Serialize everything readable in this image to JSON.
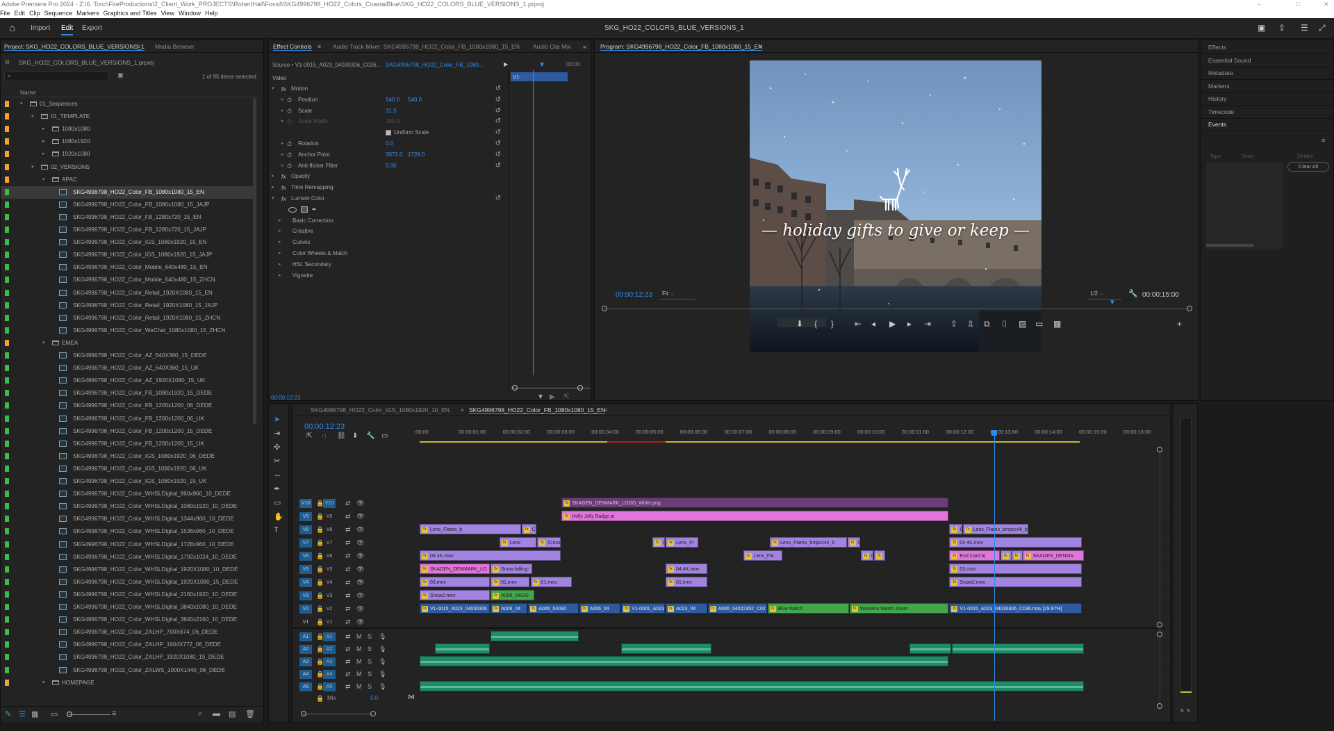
{
  "app": {
    "titlebar": "Adobe Premiere Pro 2024 - Z:\\6. TorchFireProductions\\2_Client_Work_PROJECTS\\RobertHall\\Fossil\\SKG4996798_HO22_Colors_CoastalBlue\\SKG_HO22_COLORS_BLUE_VERSIONS_1.prproj",
    "menus": [
      "File",
      "Edit",
      "Clip",
      "Sequence",
      "Markers",
      "Graphics and Titles",
      "View",
      "Window",
      "Help"
    ],
    "workspaces": [
      "Import",
      "Edit",
      "Export"
    ],
    "document_title": "SKG_HO22_COLORS_BLUE_VERSIONS_1"
  },
  "project": {
    "tab": "Project: SKG_HO22_COLORS_BLUE_VERSIONS_1",
    "tab_menu": "≡",
    "tab2": "Media Browser",
    "file": "SKG_HO22_COLORS_BLUE_VERSIONS_1.prproj",
    "count": "1 of 95 items selected",
    "col_name": "Name",
    "items": [
      {
        "t": "f",
        "d": 0,
        "n": "01_Sequences",
        "c": "#f5a230",
        "o": true
      },
      {
        "t": "f",
        "d": 1,
        "n": "01_TEMPLATE",
        "c": "#f5a230",
        "o": true
      },
      {
        "t": "f",
        "d": 2,
        "n": "1080x1080",
        "c": "#f5a230",
        "o": false
      },
      {
        "t": "f",
        "d": 2,
        "n": "1080x1920",
        "c": "#f5a230",
        "o": false
      },
      {
        "t": "f",
        "d": 2,
        "n": "1920x1080",
        "c": "#f5a230",
        "o": false
      },
      {
        "t": "f",
        "d": 1,
        "n": "02_VERSIONS",
        "c": "#f5a230",
        "o": true
      },
      {
        "t": "f",
        "d": 2,
        "n": "APAC",
        "c": "#f5a230",
        "o": true
      },
      {
        "t": "s",
        "d": 3,
        "n": "SKG4996798_HO22_Color_FB_1080x1080_15_EN",
        "c": "#3dbb47",
        "sel": true
      },
      {
        "t": "s",
        "d": 3,
        "n": "SKG4996798_HO22_Color_FB_1080x1080_15_JAJP",
        "c": "#3dbb47"
      },
      {
        "t": "s",
        "d": 3,
        "n": "SKG4996798_HO22_Color_FB_1280x720_15_EN",
        "c": "#3dbb47"
      },
      {
        "t": "s",
        "d": 3,
        "n": "SKG4996798_HO22_Color_FB_1280x720_15_JAJP",
        "c": "#3dbb47"
      },
      {
        "t": "s",
        "d": 3,
        "n": "SKG4996798_HO22_Color_IGS_1080x1920_15_EN",
        "c": "#3dbb47"
      },
      {
        "t": "s",
        "d": 3,
        "n": "SKG4996798_HO22_Color_IGS_1080x1920_15_JAJP",
        "c": "#3dbb47"
      },
      {
        "t": "s",
        "d": 3,
        "n": "SKG4996798_HO22_Color_Mobile_640x480_15_EN",
        "c": "#3dbb47"
      },
      {
        "t": "s",
        "d": 3,
        "n": "SKG4996798_HO22_Color_Mobile_640x480_15_ZHCN",
        "c": "#3dbb47"
      },
      {
        "t": "s",
        "d": 3,
        "n": "SKG4996798_HO22_Color_Retail_1920X1080_15_EN",
        "c": "#3dbb47"
      },
      {
        "t": "s",
        "d": 3,
        "n": "SKG4996798_HO22_Color_Retail_1920X1080_15_JAJP",
        "c": "#3dbb47"
      },
      {
        "t": "s",
        "d": 3,
        "n": "SKG4996798_HO22_Color_Retail_1920X1080_15_ZHCN",
        "c": "#3dbb47"
      },
      {
        "t": "s",
        "d": 3,
        "n": "SKG4996798_HO22_Color_WeChat_1080x1080_15_ZHCN",
        "c": "#3dbb47"
      },
      {
        "t": "f",
        "d": 2,
        "n": "EMEA",
        "c": "#f5a230",
        "o": true
      },
      {
        "t": "s",
        "d": 3,
        "n": "SKG4996798_HO22_Color_AZ_640X360_15_DEDE",
        "c": "#3dbb47"
      },
      {
        "t": "s",
        "d": 3,
        "n": "SKG4996798_HO22_Color_AZ_640X360_15_UK",
        "c": "#3dbb47"
      },
      {
        "t": "s",
        "d": 3,
        "n": "SKG4996798_HO22_Color_AZ_1920X1080_15_UK",
        "c": "#3dbb47"
      },
      {
        "t": "s",
        "d": 3,
        "n": "SKG4996798_HO22_Color_FB_1080x1920_15_DEDE",
        "c": "#3dbb47"
      },
      {
        "t": "s",
        "d": 3,
        "n": "SKG4996798_HO22_Color_FB_1200x1200_06_DEDE",
        "c": "#3dbb47"
      },
      {
        "t": "s",
        "d": 3,
        "n": "SKG4996798_HO22_Color_FB_1200x1200_06_UK",
        "c": "#3dbb47"
      },
      {
        "t": "s",
        "d": 3,
        "n": "SKG4996798_HO22_Color_FB_1200x1200_15_DEDE",
        "c": "#3dbb47"
      },
      {
        "t": "s",
        "d": 3,
        "n": "SKG4996798_HO22_Color_FB_1200x1200_15_UK",
        "c": "#3dbb47"
      },
      {
        "t": "s",
        "d": 3,
        "n": "SKG4996798_HO22_Color_IGS_1080x1920_06_DEDE",
        "c": "#3dbb47"
      },
      {
        "t": "s",
        "d": 3,
        "n": "SKG4996798_HO22_Color_IGS_1080x1920_06_UK",
        "c": "#3dbb47"
      },
      {
        "t": "s",
        "d": 3,
        "n": "SKG4996798_HO22_Color_IGS_1080x1920_15_UK",
        "c": "#3dbb47"
      },
      {
        "t": "s",
        "d": 3,
        "n": "SKG4996798_HO22_Color_WHSLDigital_960x960_10_DEDE",
        "c": "#3dbb47"
      },
      {
        "t": "s",
        "d": 3,
        "n": "SKG4996798_HO22_Color_WHSLDigital_1080x1920_10_DEDE",
        "c": "#3dbb47"
      },
      {
        "t": "s",
        "d": 3,
        "n": "SKG4996798_HO22_Color_WHSLDigital_1344x960_10_DEDE",
        "c": "#3dbb47"
      },
      {
        "t": "s",
        "d": 3,
        "n": "SKG4996798_HO22_Color_WHSLDigital_1536x960_10_DEDE",
        "c": "#3dbb47"
      },
      {
        "t": "s",
        "d": 3,
        "n": "SKG4996798_HO22_Color_WHSLDigital_1728x960_10_DEDE",
        "c": "#3dbb47"
      },
      {
        "t": "s",
        "d": 3,
        "n": "SKG4996798_HO22_Color_WHSLDigital_1792x1024_10_DEDE",
        "c": "#3dbb47"
      },
      {
        "t": "s",
        "d": 3,
        "n": "SKG4996798_HO22_Color_WHSLDigital_1920X1080_10_DEDE",
        "c": "#3dbb47"
      },
      {
        "t": "s",
        "d": 3,
        "n": "SKG4996798_HO22_Color_WHSLDigital_1920X1080_15_DEDE",
        "c": "#3dbb47"
      },
      {
        "t": "s",
        "d": 3,
        "n": "SKG4996798_HO22_Color_WHSLDigital_2160x1920_10_DEDE",
        "c": "#3dbb47"
      },
      {
        "t": "s",
        "d": 3,
        "n": "SKG4996798_HO22_Color_WHSLDigital_3840x1080_10_DEDE",
        "c": "#3dbb47"
      },
      {
        "t": "s",
        "d": 3,
        "n": "SKG4996798_HO22_Color_WHSLDigital_3840x2160_10_DEDE",
        "c": "#3dbb47"
      },
      {
        "t": "s",
        "d": 3,
        "n": "SKG4996798_HO22_Color_ZALHP_700X674_06_DEDE",
        "c": "#3dbb47"
      },
      {
        "t": "s",
        "d": 3,
        "n": "SKG4996798_HO22_Color_ZALHP_1604X772_06_DEDE",
        "c": "#3dbb47"
      },
      {
        "t": "s",
        "d": 3,
        "n": "SKG4996798_HO22_Color_ZALHP_1920X1080_15_DEDE",
        "c": "#3dbb47"
      },
      {
        "t": "s",
        "d": 3,
        "n": "SKG4996798_HO22_Color_ZALWS_1000X1440_06_DEDE",
        "c": "#3dbb47"
      },
      {
        "t": "f",
        "d": 2,
        "n": "HOMEPAGE",
        "c": "#f5a230",
        "o": true
      }
    ]
  },
  "effects": {
    "tabs": [
      "Effect Controls",
      "Audio Track Mixer: SKG4996798_HO22_Color_FB_1080x1080_15_EN",
      "Audio Clip Mix"
    ],
    "source": "Source • V1-0015_A023_04030306_C036...",
    "sequence": "SKG4996798_HO22_Color_FB_1080...",
    "clip_label": "V1-0015_A023_04030306",
    "ruler": "00:00",
    "video": "Video",
    "rows": [
      {
        "k": "sec",
        "label": "Motion",
        "fx": true,
        "reset": true
      },
      {
        "k": "p",
        "label": "Position",
        "v1": "540.0",
        "v2": "540.0",
        "reset": true
      },
      {
        "k": "p",
        "label": "Scale",
        "v1": "31.5",
        "reset": true
      },
      {
        "k": "p",
        "label": "Scale Width",
        "v1": "100.0",
        "dim": true,
        "reset": true
      },
      {
        "k": "chk",
        "label": "Uniform Scale",
        "reset": true
      },
      {
        "k": "p",
        "label": "Rotation",
        "v1": "0.0",
        "reset": true
      },
      {
        "k": "p",
        "label": "Anchor Point",
        "v1": "3072.0",
        "v2": "1728.0",
        "reset": true
      },
      {
        "k": "p",
        "label": "Anti-flicker Filter",
        "v1": "0.00",
        "reset": true
      },
      {
        "k": "sec",
        "label": "Opacity",
        "fx": true
      },
      {
        "k": "sec",
        "label": "Time Remapping",
        "fx": true
      },
      {
        "k": "sec",
        "label": "Lumetri Color",
        "fx": true,
        "reset": true
      },
      {
        "k": "shapes"
      },
      {
        "k": "sub",
        "label": "Basic Correction"
      },
      {
        "k": "sub",
        "label": "Creative"
      },
      {
        "k": "sub",
        "label": "Curves"
      },
      {
        "k": "sub",
        "label": "Color Wheels & Match"
      },
      {
        "k": "sub",
        "label": "HSL Secondary"
      },
      {
        "k": "sub",
        "label": "Vignette"
      }
    ],
    "timecode": "00:00:12:23"
  },
  "program": {
    "tab": "Program: SKG4996798_HO22_Color_FB_1080x1080_15_EN",
    "tab_menu": "≡",
    "caption": "— holiday gifts to give or keep —",
    "timecode": "00:00:12:23",
    "fit": "Fit",
    "resolution": "1/2",
    "duration": "00:00:15:00"
  },
  "timeline": {
    "tabs": [
      "SKG4996798_HO22_Color_IGS_1080x1920_10_EN",
      "SKG4996798_HO22_Color_FB_1080x1080_15_EN"
    ],
    "timecode": "00:00:12:23",
    "ruler": [
      ":00:00",
      "00:00:01:00",
      "00:00:02:00",
      "00:00:03:00",
      "00:00:04:00",
      "00:00:05:00",
      "00:00:06:00",
      "00:00:07:00",
      "00:00:08:00",
      "00:00:09:00",
      "00:00:10:00",
      "00:00:11:00",
      "00:00:12:00",
      "00:00:13:00",
      "00:00:14:00",
      "00:00:15:00",
      "00:00:16:00"
    ],
    "playhead_seconds": 12.96,
    "vtracks": [
      "V10",
      "V9",
      "V8",
      "V7",
      "V6",
      "V5",
      "V4",
      "V3",
      "V2",
      "V1"
    ],
    "atracks": [
      "A1",
      "A2",
      "A3",
      "A4",
      "A5"
    ],
    "mix": "Mix",
    "mix_value": "0.0",
    "vclips": [
      {
        "tr": 0,
        "s": 3.2,
        "e": 11.95,
        "n": "SKAGEN_DENMARK_LOGO_White.png",
        "c": "dpurp"
      },
      {
        "tr": 1,
        "s": 3.2,
        "e": 11.95,
        "n": "Holly Jolly Badge.ai",
        "c": "pink"
      },
      {
        "tr": 2,
        "s": 0,
        "e": 2.3,
        "n": "Lens_Flares_b",
        "c": "violet"
      },
      {
        "tr": 2,
        "s": 2.3,
        "e": 2.65,
        "n": "Cross",
        "c": "violet"
      },
      {
        "tr": 2,
        "s": 11.95,
        "e": 12.25,
        "n": "Cro",
        "c": "violet"
      },
      {
        "tr": 2,
        "s": 12.25,
        "e": 13.75,
        "n": "Lens_Flares_bmpcc4k_by_",
        "c": "violet"
      },
      {
        "tr": 3,
        "s": 1.8,
        "e": 2.65,
        "n": "Lens",
        "c": "violet"
      },
      {
        "tr": 3,
        "s": 2.65,
        "e": 3.2,
        "n": "Cross D",
        "c": "violet"
      },
      {
        "tr": 3,
        "s": 5.25,
        "e": 5.55,
        "n": "Cro",
        "c": "violet"
      },
      {
        "tr": 3,
        "s": 5.55,
        "e": 6.3,
        "n": "Lens_Fl",
        "c": "violet"
      },
      {
        "tr": 3,
        "s": 7.9,
        "e": 9.65,
        "n": "Lens_Flares_bmpcc4k_b",
        "c": "violet"
      },
      {
        "tr": 3,
        "s": 9.65,
        "e": 9.95,
        "n": "Cr",
        "c": "violet"
      },
      {
        "tr": 3,
        "s": 11.95,
        "e": 14.95,
        "n": "04 4K.mov",
        "c": "violet"
      },
      {
        "tr": 4,
        "s": 0,
        "e": 3.2,
        "n": "04 4K.mov",
        "c": "violet"
      },
      {
        "tr": 4,
        "s": 7.3,
        "e": 8.2,
        "n": "Lens_Fla",
        "c": "violet"
      },
      {
        "tr": 4,
        "s": 9.95,
        "e": 10.25,
        "n": "Cr",
        "c": "violet"
      },
      {
        "tr": 4,
        "s": 10.25,
        "e": 10.5,
        "n": "Cr",
        "c": "violet"
      },
      {
        "tr": 4,
        "s": 11.95,
        "e": 13.1,
        "n": "End Card.ai",
        "c": "pink"
      },
      {
        "tr": 4,
        "s": 13.1,
        "e": 13.35,
        "n": "Cr",
        "c": "violet"
      },
      {
        "tr": 4,
        "s": 13.35,
        "e": 13.6,
        "n": "Cr",
        "c": "violet"
      },
      {
        "tr": 4,
        "s": 13.6,
        "e": 15,
        "n": "SKAGEN_DENMA",
        "c": "pink"
      },
      {
        "tr": 5,
        "s": 0,
        "e": 1.6,
        "n": "SKAGEN_DENMARK_LO",
        "c": "pink"
      },
      {
        "tr": 5,
        "s": 1.6,
        "e": 2.55,
        "n": "Snow-falling-",
        "c": "violet"
      },
      {
        "tr": 5,
        "s": 5.55,
        "e": 6.5,
        "n": "04 4K.mov",
        "c": "violet"
      },
      {
        "tr": 5,
        "s": 11.95,
        "e": 14.95,
        "n": "03.mov",
        "c": "violet"
      },
      {
        "tr": 6,
        "s": 0,
        "e": 1.6,
        "n": "03.mov",
        "c": "violet"
      },
      {
        "tr": 6,
        "s": 1.6,
        "e": 2.5,
        "n": "01.mov",
        "c": "violet"
      },
      {
        "tr": 6,
        "s": 2.5,
        "e": 3.45,
        "n": "01.mov",
        "c": "violet"
      },
      {
        "tr": 6,
        "s": 5.55,
        "e": 6.5,
        "n": "01.mov",
        "c": "violet"
      },
      {
        "tr": 6,
        "s": 11.95,
        "e": 14.95,
        "n": "Snow2.mov",
        "c": "violet"
      },
      {
        "tr": 7,
        "s": 0,
        "e": 1.6,
        "n": "Snow2.mov",
        "c": "violet"
      },
      {
        "tr": 7,
        "s": 1.6,
        "e": 2.6,
        "n": "A006_04030",
        "c": "green"
      },
      {
        "tr": 8,
        "s": 0,
        "e": 1.6,
        "n": "V1-0015_A023_04030306",
        "c": "vclip"
      },
      {
        "tr": 8,
        "s": 1.6,
        "e": 2.45,
        "n": "A006_04",
        "c": "vclip"
      },
      {
        "tr": 8,
        "s": 2.45,
        "e": 3.6,
        "n": "A006_04030",
        "c": "vclip"
      },
      {
        "tr": 8,
        "s": 3.6,
        "e": 4.55,
        "n": "A006_04",
        "c": "vclip"
      },
      {
        "tr": 8,
        "s": 4.55,
        "e": 5.55,
        "n": "V1-0001_A023_",
        "c": "vclip"
      },
      {
        "tr": 8,
        "s": 5.55,
        "e": 6.5,
        "n": "A023_04",
        "c": "vclip"
      },
      {
        "tr": 8,
        "s": 6.5,
        "e": 7.85,
        "n": "A006_04022352_C021.b",
        "c": "vclip"
      },
      {
        "tr": 8,
        "s": 7.85,
        "e": 9.7,
        "n": "Blue Watch",
        "c": "green"
      },
      {
        "tr": 8,
        "s": 9.7,
        "e": 11.95,
        "n": "Womens Watch Zoom",
        "c": "green"
      },
      {
        "tr": 8,
        "s": 11.95,
        "e": 14.95,
        "n": "V1-0015_A023_04030306_C036.mov [29.97%]",
        "c": "vclip"
      }
    ],
    "aclips": [
      {
        "tr": 0,
        "s": 1.6,
        "e": 3.6
      },
      {
        "tr": 1,
        "s": 0.35,
        "e": 1.6
      },
      {
        "tr": 1,
        "s": 4.55,
        "e": 6.6
      },
      {
        "tr": 1,
        "s": 11.05,
        "e": 12.0
      },
      {
        "tr": 1,
        "s": 12.0,
        "e": 15.0
      },
      {
        "tr": 2,
        "s": 0,
        "e": 11.95
      },
      {
        "tr": 4,
        "s": 0,
        "e": 15.0
      }
    ]
  },
  "right_panels": [
    "Effects",
    "Essential Sound",
    "Metadata",
    "Markers",
    "History",
    "Timecode",
    "Events"
  ],
  "events": {
    "cols": [
      "Type",
      "Time",
      "Details"
    ],
    "clear": "Clear All"
  },
  "colors": {
    "accent": "#2d8ceb",
    "folder": "#f5a230",
    "sequence": "#3dbb47",
    "playhead": "#2d8ceb"
  }
}
